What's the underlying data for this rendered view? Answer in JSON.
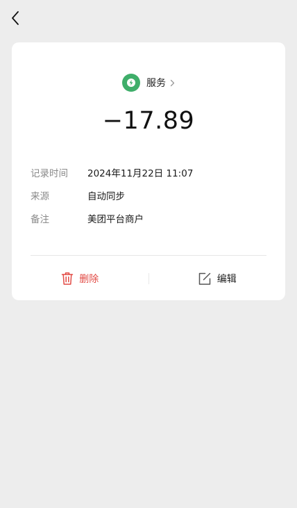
{
  "nav": {
    "back_icon": "chevron-left-icon"
  },
  "record": {
    "category": {
      "icon": "service-bolt-icon",
      "icon_color": "#3fae6a",
      "label": "服务"
    },
    "amount": "−17.89",
    "details": [
      {
        "label": "记录时间",
        "value": "2024年11月22日 11:07"
      },
      {
        "label": "来源",
        "value": "自动同步"
      },
      {
        "label": "备注",
        "value": "美团平台商户"
      }
    ]
  },
  "actions": {
    "delete_label": "删除",
    "delete_color": "#e24a44",
    "edit_label": "编辑"
  }
}
